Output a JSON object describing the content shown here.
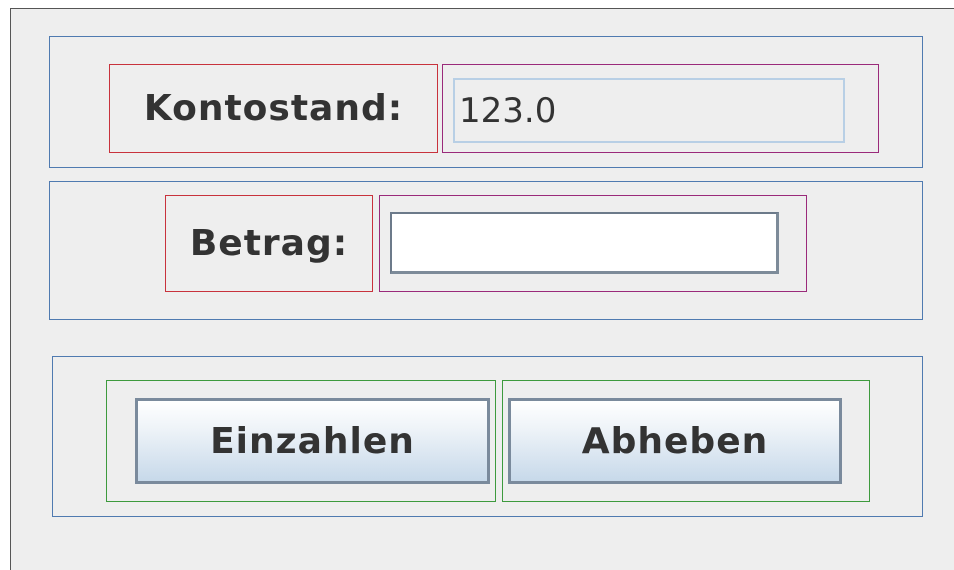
{
  "balance": {
    "label": "Kontostand:",
    "value": "123.0"
  },
  "amount": {
    "label": "Betrag:",
    "value": "",
    "placeholder": ""
  },
  "actions": {
    "deposit_label": "Einzahlen",
    "withdraw_label": "Abheben"
  },
  "colors": {
    "window_background": "#eeeeee",
    "panel_border": "#4f7ab0",
    "label_border": "#c8323c",
    "field_border": "#9a2a7a",
    "button_border": "#3d9a3d",
    "button_gradient_bottom": "#c7d9ea",
    "readout_border": "#b8cfe5"
  }
}
